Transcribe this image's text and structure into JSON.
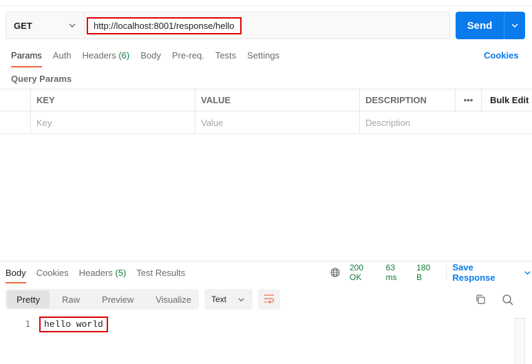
{
  "request": {
    "method": "GET",
    "url": "http://localhost:8001/response/hello",
    "send_label": "Send"
  },
  "request_tabs": [
    {
      "label": "Params",
      "count": ""
    },
    {
      "label": "Auth",
      "count": ""
    },
    {
      "label": "Headers",
      "count": "(6)"
    },
    {
      "label": "Body",
      "count": ""
    },
    {
      "label": "Pre-req.",
      "count": ""
    },
    {
      "label": "Tests",
      "count": ""
    },
    {
      "label": "Settings",
      "count": ""
    }
  ],
  "cookies_label": "Cookies",
  "query_params": {
    "title": "Query Params",
    "headers": {
      "key": "KEY",
      "value": "VALUE",
      "description": "DESCRIPTION",
      "more": "•••",
      "bulk_edit": "Bulk Edit"
    },
    "placeholders": {
      "key": "Key",
      "value": "Value",
      "description": "Description"
    }
  },
  "response": {
    "tabs": [
      {
        "label": "Body",
        "count": ""
      },
      {
        "label": "Cookies",
        "count": ""
      },
      {
        "label": "Headers",
        "count": "(5)"
      },
      {
        "label": "Test Results",
        "count": ""
      }
    ],
    "status": "200 OK",
    "time": "63 ms",
    "size": "180 B",
    "save_label": "Save Response",
    "views": [
      "Pretty",
      "Raw",
      "Preview",
      "Visualize"
    ],
    "format": "Text",
    "lines": [
      {
        "no": "1",
        "text": "hello world"
      }
    ]
  },
  "colors": {
    "accent": "#097bed",
    "tab_underline": "#f26b3a",
    "status_ok": "#0f7b3a",
    "highlight": "#e00000"
  }
}
